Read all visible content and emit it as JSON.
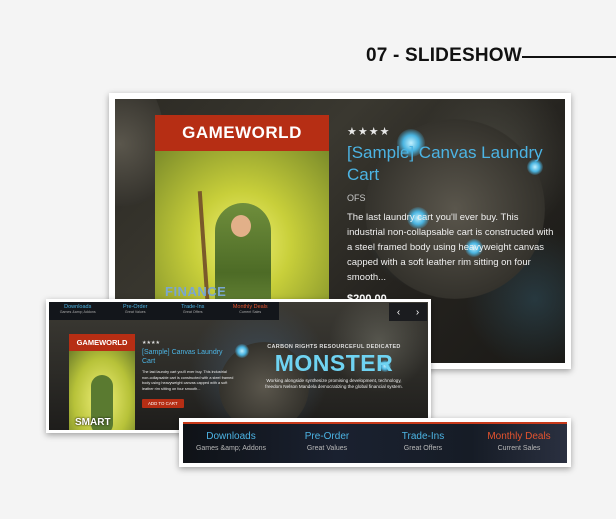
{
  "heading": "07 - SLIDESHOW",
  "main_slide": {
    "card_banner": "GAMEWORLD",
    "card_caption": "FINANCE",
    "stars": "★★★★",
    "product_title": "[Sample] Canvas Laundry Cart",
    "vendor": "OFS",
    "description": "The last laundry cart you'll ever buy. This industrial non-collapsable cart is constructed with a steel framed body using heavyweight canvas capped with a soft leather rim sitting on four smooth...",
    "price": "$200.00"
  },
  "mini_slide": {
    "nav": [
      {
        "label": "Downloads",
        "sub": "Games &amp; Addons"
      },
      {
        "label": "Pre-Order",
        "sub": "Great Values"
      },
      {
        "label": "Trade-Ins",
        "sub": "Great Offers"
      },
      {
        "label": "Monthly Deals",
        "sub": "Current Sales"
      }
    ],
    "arrow_prev": "‹",
    "arrow_next": "›",
    "card_banner": "GAMEWORLD",
    "card_caption": "SMART",
    "stars": "★★★★",
    "product_title": "[Sample] Canvas Laundry Cart",
    "description": "The last laundry cart you'll ever buy. This industrial non-collapsable cart is constructed with a steel framed body using heavyweight canvas capped with a soft leather rim sitting on four smooth...",
    "button": "ADD TO CART",
    "promo_sub": "CARBON RIGHTS RESOURCEFUL DEDICATED",
    "promo_title": "MONSTER",
    "promo_text": "Working alongside synthesize promising development, technology, freedom Nelson Mandela democratizing the global financial system."
  },
  "bottom_nav": [
    {
      "label": "Downloads",
      "sub": "Games &amp; Addons"
    },
    {
      "label": "Pre-Order",
      "sub": "Great Values"
    },
    {
      "label": "Trade-Ins",
      "sub": "Great Offers"
    },
    {
      "label": "Monthly Deals",
      "sub": "Current Sales"
    }
  ],
  "colors": {
    "accent_blue": "#4cb4e4",
    "accent_red": "#e5532e",
    "banner_red": "#b62e14"
  }
}
